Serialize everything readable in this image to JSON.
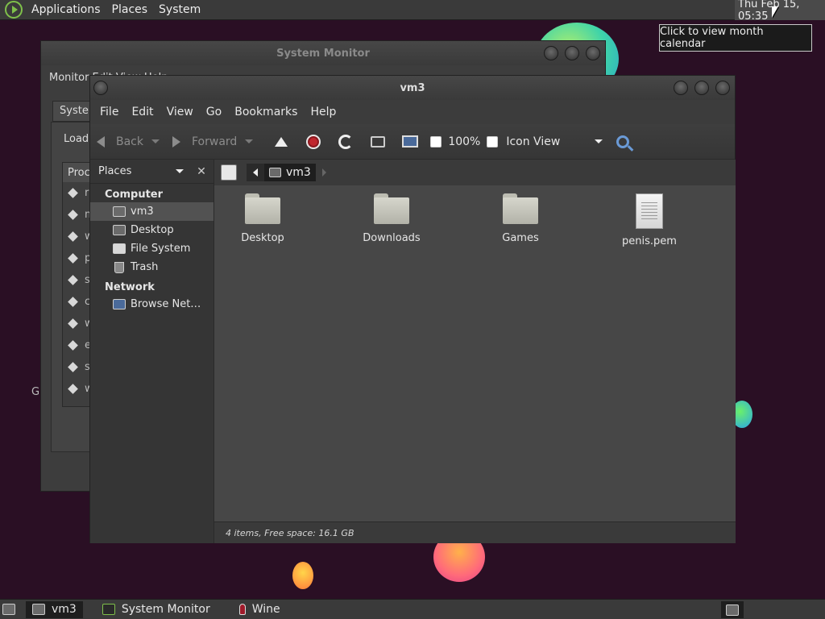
{
  "top_panel": {
    "menus": [
      "Applications",
      "Places",
      "System"
    ],
    "clock": "Thu Feb 15, 05:35",
    "tooltip": "Click to view month calendar"
  },
  "system_monitor": {
    "title": "System Monitor",
    "menu": "Monitor  Edit  View  Help",
    "tab": "System",
    "load_label": "Load",
    "list_header": "Proc",
    "rows": [
      "ru",
      "m",
      "w",
      "p",
      "sy",
      "ca",
      "w",
      "ex",
      "se",
      "w"
    ],
    "side_letter": "G"
  },
  "file_manager": {
    "title": "vm3",
    "menu": [
      "File",
      "Edit",
      "View",
      "Go",
      "Bookmarks",
      "Help"
    ],
    "toolbar": {
      "back": "Back",
      "forward": "Forward",
      "zoom": "100%",
      "view_mode": "Icon View"
    },
    "sidebar": {
      "selector": "Places",
      "close": "✕",
      "computer_heading": "Computer",
      "computer_items": [
        "vm3",
        "Desktop",
        "File System",
        "Trash"
      ],
      "network_heading": "Network",
      "network_items": [
        "Browse Net…"
      ]
    },
    "location": {
      "current": "vm3"
    },
    "files": [
      {
        "name": "Desktop",
        "kind": "folder"
      },
      {
        "name": "Downloads",
        "kind": "folder"
      },
      {
        "name": "Games",
        "kind": "folder"
      },
      {
        "name": "penis.pem",
        "kind": "document"
      }
    ],
    "status": "4 items, Free space: 16.1 GB"
  },
  "taskbar": {
    "tasks": [
      "vm3",
      "System Monitor",
      "Wine"
    ]
  },
  "icons": {
    "logo": "distro-logo-icon",
    "stop": "stop-icon",
    "reload": "reload-icon",
    "home": "home-icon",
    "computer": "computer-icon",
    "search": "search-icon"
  }
}
